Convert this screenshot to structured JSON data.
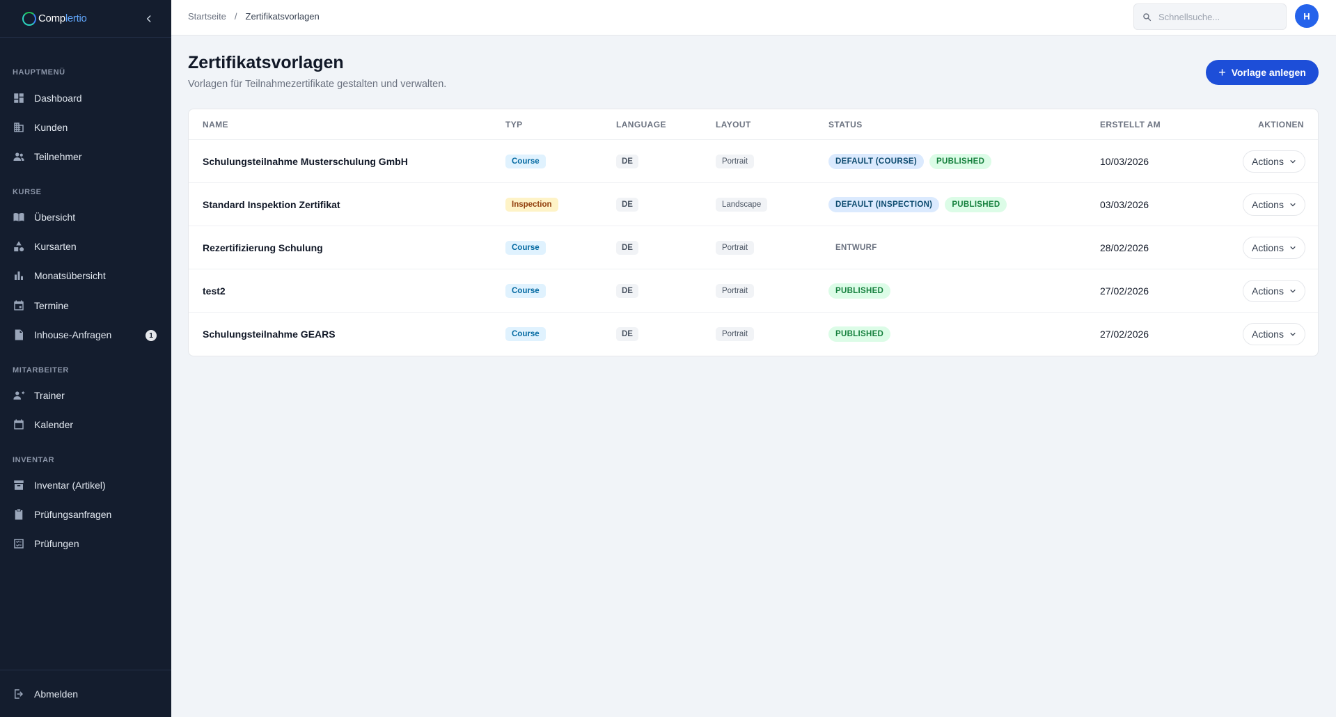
{
  "app": {
    "logo_part1": "Comp",
    "logo_part2": "lertio"
  },
  "sidebar": {
    "sections": [
      {
        "label": "HAUPTMENÜ"
      },
      {
        "label": "KURSE"
      },
      {
        "label": "MITARBEITER"
      },
      {
        "label": "INVENTAR"
      }
    ],
    "items": [
      {
        "label": "Dashboard",
        "icon": "dashboard-icon"
      },
      {
        "label": "Kunden",
        "icon": "building-icon"
      },
      {
        "label": "Teilnehmer",
        "icon": "people-icon"
      },
      {
        "label": "Übersicht",
        "icon": "book-icon"
      },
      {
        "label": "Kursarten",
        "icon": "shapes-icon"
      },
      {
        "label": "Monatsübersicht",
        "icon": "bar-chart-icon"
      },
      {
        "label": "Termine",
        "icon": "calendar-event-icon"
      },
      {
        "label": "Inhouse-Anfragen",
        "icon": "document-icon",
        "badge": "1"
      },
      {
        "label": "Trainer",
        "icon": "trainer-icon"
      },
      {
        "label": "Kalender",
        "icon": "calendar-icon"
      },
      {
        "label": "Inventar (Artikel)",
        "icon": "archive-icon"
      },
      {
        "label": "Prüfungsanfragen",
        "icon": "clipboard-icon"
      },
      {
        "label": "Prüfungen",
        "icon": "checklist-icon"
      }
    ],
    "logout_label": "Abmelden"
  },
  "header": {
    "breadcrumb": [
      "Startseite",
      "/",
      "Zertifikatsvorlagen"
    ],
    "search_placeholder": "Schnellsuche...",
    "avatar_initial": "H"
  },
  "page": {
    "title": "Zertifikatsvorlagen",
    "subtitle": "Vorlagen für Teilnahmezertifikate gestalten und verwalten.",
    "create_button": "Vorlage anlegen"
  },
  "table": {
    "columns": [
      "NAME",
      "TYP",
      "LANGUAGE",
      "LAYOUT",
      "STATUS",
      "ERSTELLT AM",
      "AKTIONEN"
    ],
    "rows": [
      {
        "name": "Schulungsteilnahme Musterschulung GmbH",
        "type": "Course",
        "language": "DE",
        "layout": "Portrait",
        "status": [
          "DEFAULT (COURSE)",
          "PUBLISHED"
        ],
        "created": "10/03/2026",
        "actions": "Actions"
      },
      {
        "name": "Standard Inspektion Zertifikat",
        "type": "Inspection",
        "language": "DE",
        "layout": "Landscape",
        "status": [
          "DEFAULT (INSPECTION)",
          "PUBLISHED"
        ],
        "created": "03/03/2026",
        "actions": "Actions"
      },
      {
        "name": "Rezertifizierung Schulung",
        "type": "Course",
        "language": "DE",
        "layout": "Portrait",
        "status": [
          "ENTWURF"
        ],
        "created": "28/02/2026",
        "actions": "Actions"
      },
      {
        "name": "test2",
        "type": "Course",
        "language": "DE",
        "layout": "Portrait",
        "status": [
          "PUBLISHED"
        ],
        "created": "27/02/2026",
        "actions": "Actions"
      },
      {
        "name": "Schulungsteilnahme GEARS",
        "type": "Course",
        "language": "DE",
        "layout": "Portrait",
        "status": [
          "PUBLISHED"
        ],
        "created": "27/02/2026",
        "actions": "Actions"
      }
    ]
  },
  "colors": {
    "sidebar_bg": "#141d2e",
    "primary": "#1d4ed8",
    "page_bg": "#f1f4f8",
    "published": "#15803d",
    "course": "#0369a1",
    "inspection": "#92400e"
  }
}
